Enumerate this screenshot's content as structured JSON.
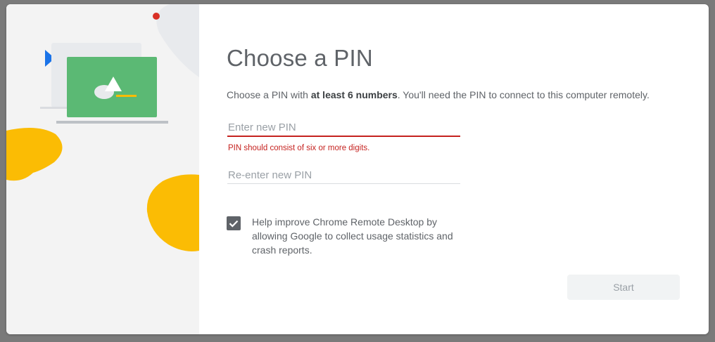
{
  "dialog": {
    "title": "Choose a PIN",
    "subtitle_prefix": "Choose a PIN with ",
    "subtitle_bold": "at least 6 numbers",
    "subtitle_suffix": ". You'll need the PIN to connect to this computer remotely.",
    "pin_field": {
      "placeholder": "Enter new PIN",
      "value": "",
      "error": "PIN should consist of six or more digits."
    },
    "repin_field": {
      "placeholder": "Re-enter new PIN",
      "value": ""
    },
    "consent": {
      "checked": true,
      "label": "Help improve Chrome Remote Desktop by allowing Google to collect usage statistics and crash reports."
    },
    "start_button": {
      "label": "Start",
      "enabled": false
    }
  },
  "colors": {
    "illustration_background": "#f3f3f3",
    "yellow_blob": "#fbbc04",
    "green_screen": "#5bb974",
    "blue_arrow": "#1a73e8",
    "red_dot": "#d93025",
    "error": "#c5221f",
    "checkbox": "#5f6368",
    "title_text": "#5f6368"
  },
  "icons": {
    "illustration": "laptop-remote-illustration",
    "checkbox": "check-icon"
  }
}
